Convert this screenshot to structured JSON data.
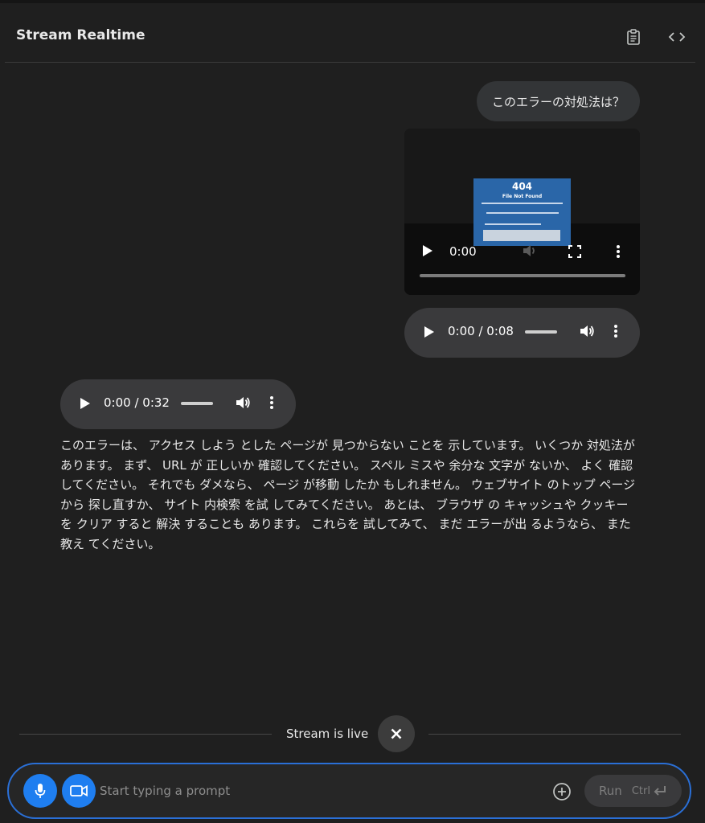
{
  "header": {
    "title": "Stream Realtime"
  },
  "chat": {
    "user_message": "このエラーの対処法は？",
    "video": {
      "time": "0:00",
      "frame_code": "404",
      "frame_subtitle": "File Not Found"
    },
    "user_audio": {
      "time": "0:00 / 0:08"
    },
    "model_audio": {
      "time": "0:00 / 0:32"
    },
    "model_reply": "このエラーは、 アクセス しよう とした ページが 見つからない ことを 示しています。 いくつか 対処法が あります。 まず、 URL が 正しいか 確認してください。 スペル ミスや 余分な 文字が ないか、 よく 確認 してください。 それでも ダメなら、 ページ が移動 したか もしれません。 ウェブサイト のトップ ページから 探し直すか、 サイト 内検索 を試 してみてください。 あとは、 ブラウザ の キャッシュや クッキーを クリア すると 解決 することも あります。 これらを 試してみて、 まだ エラーが出 るようなら、 また 教え てください。"
  },
  "stream": {
    "status": "Stream is live"
  },
  "input": {
    "placeholder": "Start typing a prompt",
    "run_label": "Run",
    "shortcut_label": "Ctrl"
  },
  "colors": {
    "background": "#1f1f1f",
    "bubble": "#333537",
    "accent_blue": "#1f7ef0",
    "input_border": "#2a6fd6"
  },
  "icons": [
    "clipboard-icon",
    "code-icon",
    "play-icon",
    "volume-icon",
    "more-vert-icon",
    "fullscreen-icon",
    "close-icon",
    "mic-icon",
    "video-camera-icon",
    "add-circle-icon",
    "enter-icon"
  ]
}
